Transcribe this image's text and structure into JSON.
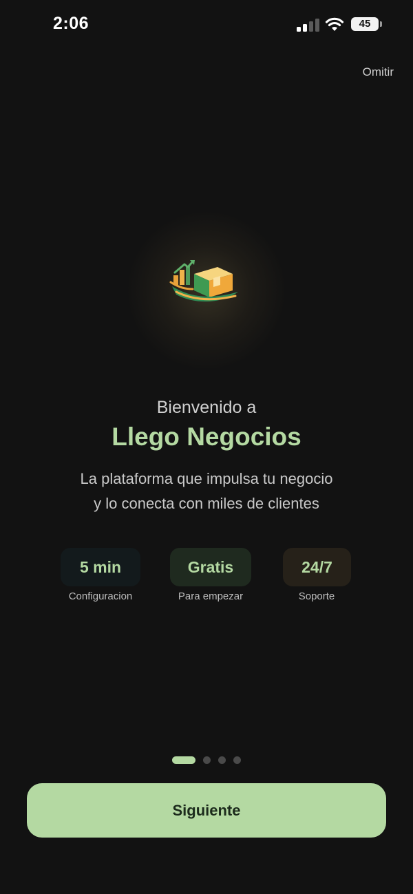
{
  "status_bar": {
    "time": "2:06",
    "battery": "45",
    "icons": [
      "signal-icon",
      "wifi-icon",
      "battery-icon"
    ]
  },
  "header": {
    "skip_label": "Omitir"
  },
  "hero": {
    "logo_icon": "box-growth-logo-icon",
    "welcome": "Bienvenido a",
    "app_name": "Llego Negocios",
    "subtitle_line1": "La plataforma que impulsa tu negocio",
    "subtitle_line2": "y lo conecta con miles de clientes"
  },
  "stats": [
    {
      "value": "5 min",
      "label": "Configuracion"
    },
    {
      "value": "Gratis",
      "label": "Para empezar"
    },
    {
      "value": "24/7",
      "label": "Soporte"
    }
  ],
  "pagination": {
    "total": 4,
    "current": 1
  },
  "footer": {
    "next_label": "Siguiente"
  },
  "colors": {
    "background": "#121212",
    "accent": "#b4d9a2",
    "button_text": "#1c2b1c"
  }
}
